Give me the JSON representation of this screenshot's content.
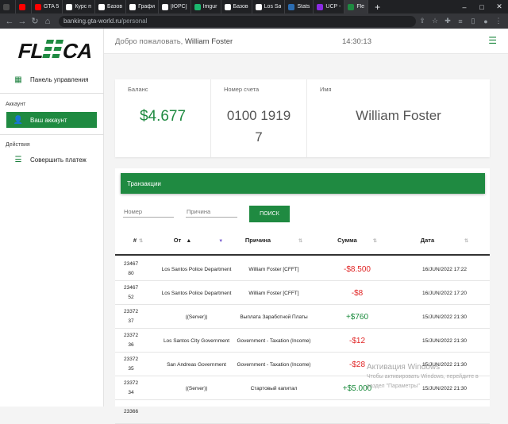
{
  "browser": {
    "tabs": [
      {
        "title": "",
        "color": "#4a4a4a"
      },
      {
        "title": "",
        "color": "#ff0000"
      },
      {
        "title": "GTA 5",
        "color": "#ff0000"
      },
      {
        "title": "Курс п",
        "color": "#ffffff"
      },
      {
        "title": "Базов",
        "color": "#ffffff"
      },
      {
        "title": "Графи",
        "color": "#ffffff"
      },
      {
        "title": "[ЮРС]",
        "color": "#ffffff"
      },
      {
        "title": "Imgur",
        "color": "#1bb76e"
      },
      {
        "title": "Базов",
        "color": "#ffffff"
      },
      {
        "title": "Los Sa",
        "color": "#ffffff"
      },
      {
        "title": "Stats",
        "color": "#2b6cb0"
      },
      {
        "title": "UCP -",
        "color": "#8a2be2"
      },
      {
        "title": "Fle",
        "color": "#1f8a41"
      }
    ],
    "new_tab": "+",
    "url_host": "banking.gta-world.ru",
    "url_path": "/personal",
    "win_min": "–",
    "win_max": "□",
    "win_close": "✕"
  },
  "sidebar": {
    "dashboard": "Панель управления",
    "section_account": "Аккаунт",
    "account": "Ваш аккаунт",
    "section_actions": "Действия",
    "payment": "Совершить платеж"
  },
  "header": {
    "welcome": "Добро пожаловать,",
    "user": "William Foster",
    "time": "14:30:13"
  },
  "cards": {
    "balance_label": "Баланс",
    "balance_value": "$4.677",
    "account_label": "Номер счета",
    "account_line1": "0100 1919",
    "account_line2": "7",
    "name_label": "Имя",
    "name_value": "William Foster"
  },
  "transactions": {
    "title": "Транзакции",
    "filter_number_placeholder": "Номер",
    "filter_reason_placeholder": "Причина",
    "search_label": "ПОИСК",
    "columns": {
      "num": "#",
      "from": "От",
      "reason": "Причина",
      "amount": "Сумма",
      "date": "Дата"
    },
    "rows": [
      {
        "n1": "23467",
        "n2": "80",
        "from": "Los Santos Police Department",
        "reason": "William Foster [CFFT]",
        "amount": "-$8.500",
        "date": "16/JUN/2022 17:22"
      },
      {
        "n1": "23467",
        "n2": "52",
        "from": "Los Santos Police Department",
        "reason": "William Foster [CFFT]",
        "amount": "-$8",
        "date": "16/JUN/2022 17:20"
      },
      {
        "n1": "23372",
        "n2": "37",
        "from": "((Server))",
        "reason": "Выплата Заработной Платы",
        "amount": "+$760",
        "date": "15/JUN/2022 21:30"
      },
      {
        "n1": "23372",
        "n2": "36",
        "from": "Los Santos City Government",
        "reason": "Government - Taxation (Income)",
        "amount": "-$12",
        "date": "15/JUN/2022 21:30"
      },
      {
        "n1": "23372",
        "n2": "35",
        "from": "San Andreas Government",
        "reason": "Government - Taxation (Income)",
        "amount": "-$28",
        "date": "15/JUN/2022 21:30"
      },
      {
        "n1": "23372",
        "n2": "34",
        "from": "((Server))",
        "reason": "Стартовый капитал",
        "amount": "+$5.000",
        "date": "15/JUN/2022 21:30"
      },
      {
        "n1": "23366",
        "n2": "",
        "from": "",
        "reason": "",
        "amount": "",
        "date": ""
      }
    ]
  },
  "watermark": {
    "line1": "Активация Windows",
    "line2": "Чтобы активировать Windows, перейдите в",
    "line3": "раздел \"Параметры\""
  },
  "colors": {
    "accent": "#1f8a41",
    "negative": "#e02424",
    "positive": "#1a8a3c"
  }
}
